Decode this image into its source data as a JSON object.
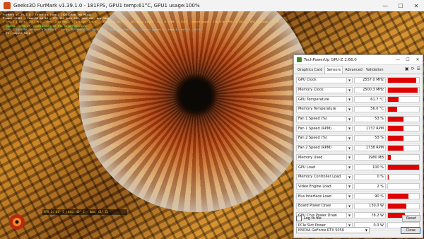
{
  "titlebar": {
    "title": "Geeks3D FurMark v1.39.1.0 - 181FPS, GPU1 temp:61°C, GPU1 usage:100%",
    "minimize_icon": "minimize-icon",
    "maximize_icon": "maximize-icon",
    "close_icon": "close-icon"
  },
  "hud": {
    "lines": [
      {
        "text": "FurMark v1.39.1.0 - Entry in local, 1920x1080 (NO MSAA)",
        "color": "w"
      },
      {
        "text": "Frames:47867 - time:00:04:26 - FPS:181 (min:154, max:184, avg:180)",
        "color": "w"
      },
      {
        "text": "[ GPU-Z ] core: 2557 MHz - mem: 2500 MHz - GPU load: 100 % - GPU temp: 61 °C - GPU chip power: 78.2 W (PPW: 2.315) - Board power: 130.0 W (PPW: 1.392) - GPU voltage: 0.895 V",
        "color": "y"
      },
      {
        "text": "- OpenGL renderer: NVIDIA GeForce RTX 5050/PCIe/SSE2",
        "color": "g"
      },
      {
        "text": "- GPU 1 (NVIDIA GeForce RTX 5050) - core: 2557MHz/61°C/100%, mem: 2500MHz, fan: 53%, limits:[power:1, temp:0, volt:0, OV:0]",
        "color": "c"
      },
      {
        "text": "- F1: toggle help",
        "color": "w"
      }
    ]
  },
  "bottom_hud": {
    "text": "GPU 1: 61° C (min: 40° C - max: 61° C)"
  },
  "gpuz": {
    "title": "TechPowerUp GPU-Z 2.66.0",
    "tabs": [
      "Graphics Card",
      "Sensors",
      "Advanced",
      "Validation"
    ],
    "active_tab": "Sensors",
    "sensors": [
      {
        "label": "GPU Clock",
        "value": "2557.0 MHz",
        "level": 0.92
      },
      {
        "label": "Memory Clock",
        "value": "2500.3 MHz",
        "level": 0.95
      },
      {
        "label": "GPU Temperature",
        "value": "61.7 °C",
        "level": 0.35
      },
      {
        "label": "Memory Temperature",
        "value": "56.0 °C",
        "level": 0.3
      },
      {
        "label": "Fan 1 Speed (%)",
        "value": "53 %",
        "level": 0.5
      },
      {
        "label": "Fan 1 Speed (RPM)",
        "value": "1737 RPM",
        "level": 0.5
      },
      {
        "label": "Fan 2 Speed (%)",
        "value": "53 %",
        "level": 0.5
      },
      {
        "label": "Fan 2 Speed (RPM)",
        "value": "1738 RPM",
        "level": 0.5
      },
      {
        "label": "Memory Used",
        "value": "1980 MB",
        "level": 0.08
      },
      {
        "label": "GPU Load",
        "value": "100 %",
        "level": 1.0
      },
      {
        "label": "Memory Controller Load",
        "value": "0 %",
        "level": 0.03
      },
      {
        "label": "Video Engine Load",
        "value": "2 %",
        "level": 0.0
      },
      {
        "label": "Bus Interface Load",
        "value": "90 %",
        "level": 0.65
      },
      {
        "label": "Board Power Draw",
        "value": "130.0 W",
        "level": 0.6
      },
      {
        "label": "GPU Chip Power Draw",
        "value": "78.2 W",
        "level": 0.55
      },
      {
        "label": "PCIe Slot Power",
        "value": "0.0 W",
        "level": 0.0
      }
    ],
    "log_to_file": "Log to file",
    "reset": "Reset",
    "gpu_select": "NVIDIA GeForce RTX 5050",
    "close": "Close"
  },
  "colors": {
    "bar_fill": "#e00000"
  }
}
